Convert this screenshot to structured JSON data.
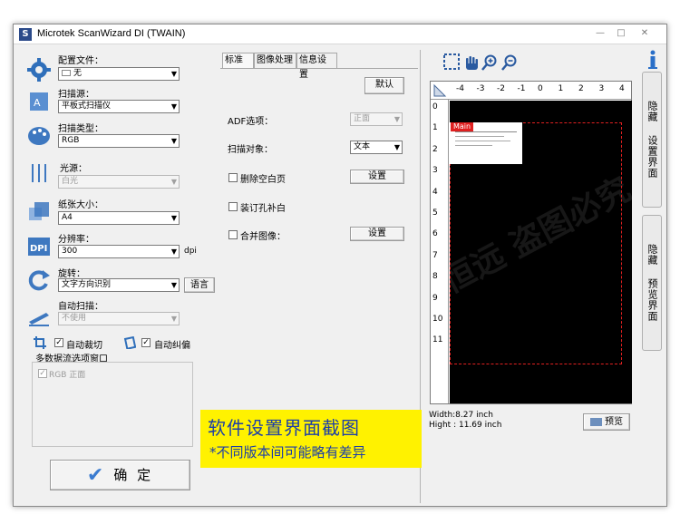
{
  "window": {
    "title": "Microtek ScanWizard DI (TWAIN)",
    "controls": [
      "—",
      "□",
      "✕"
    ]
  },
  "left": {
    "config_label": "配置文件：",
    "config_value": "无",
    "source_label": "扫描源：",
    "source_value": "平板式扫描仪",
    "type_label": "扫描类型：",
    "type_value": "RGB",
    "light_label": "光源：",
    "light_value": "白光",
    "paper_label": "纸张大小：",
    "paper_value": "A4",
    "res_label": "分辨率：",
    "res_value": "300",
    "res_unit": "dpi",
    "rotate_label": "旋转：",
    "rotate_value": "文字方向识别",
    "language_button": "语言",
    "auto_scan_label": "自动扫描：",
    "auto_scan_value": "不使用",
    "auto_crop_label": "自动裁切",
    "auto_deskew_label": "自动纠偏",
    "multi_stream_label": "多数据流选项窗口",
    "multi_stream_item": "RGB 正面",
    "ok_button": "确 定",
    "checkmark": "✓"
  },
  "tabs": [
    {
      "label": "标准"
    },
    {
      "label": "图像处理"
    },
    {
      "label": "信息设置"
    }
  ],
  "standard": {
    "default_button": "默认",
    "adf_label": "ADF选项：",
    "adf_value": "正面",
    "object_label": "扫描对象：",
    "object_value": "文本",
    "remove_blank_label": "删除空白页",
    "binding_label": "装订孔补白",
    "merge_label": "合并图像：",
    "settings_button": "设置",
    "settings_button_2": "设置"
  },
  "preview": {
    "main_tag": "Main",
    "ruler_top": [
      "-4",
      "-3",
      "-2",
      "-1",
      "0",
      "1",
      "2",
      "3",
      "4"
    ],
    "ruler_left": [
      "0",
      "1",
      "2",
      "3",
      "4",
      "5",
      "6",
      "7",
      "8",
      "9",
      "10",
      "11"
    ],
    "width_text": "Width:8.27 inch",
    "height_text": "Hight : 11.69 inch",
    "preview_button": "预览"
  },
  "side": {
    "hide_settings": "隐藏 设置界面",
    "hide_preview": "隐藏 预览界面"
  },
  "overlay": {
    "title": "软件设置界面截图",
    "subtitle": "*不同版本间可能略有差异"
  },
  "colors": {
    "overlay_bg": "#fff200",
    "overlay_text": "#1c3ea8",
    "crop_frame": "#e02020"
  }
}
